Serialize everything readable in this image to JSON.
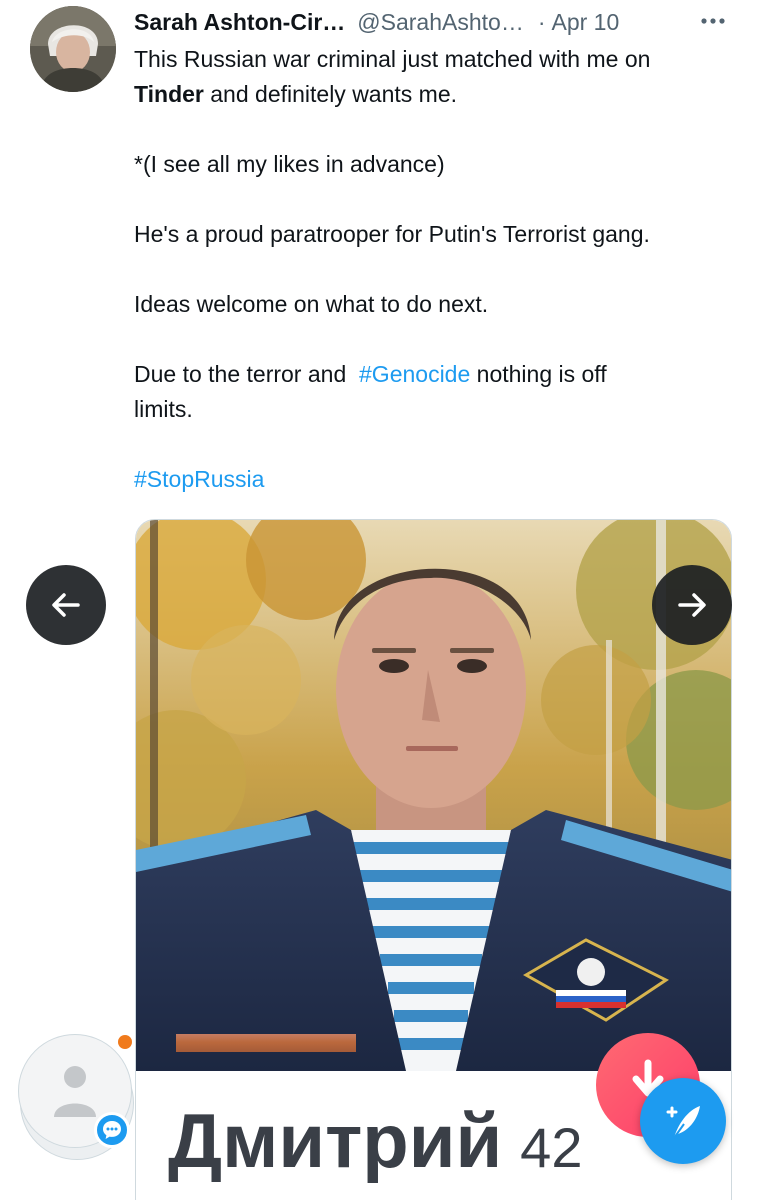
{
  "tweet": {
    "display_name": "Sarah Ashton-Cir…",
    "handle": "@SarahAshto…",
    "separator": "·",
    "date": "Apr 10",
    "more_icon": "more-horizontal-icon",
    "text": {
      "line1": "This Russian war criminal just matched with me on",
      "line2_bold": "Tinder",
      "line2_rest": " and definitely wants me.",
      "line3": "*(I see all my likes in advance)",
      "line4": "He's a proud paratrooper for Putin's Terrorist gang.",
      "line5": "Ideas welcome on what to do next.",
      "line6_start": "Due to the terror and  ",
      "line6_hashtag": "#Genocide",
      "line6_end": " nothing is off",
      "line7": "limits.",
      "hashtag2": "#StopRussia"
    }
  },
  "media": {
    "profile_name": "Дмитрий",
    "profile_age": "42"
  },
  "carousel": {
    "prev_icon": "arrow-left-icon",
    "next_icon": "arrow-right-icon"
  },
  "floating": {
    "tinder_action_icon": "arrow-down-icon",
    "compose_icon": "compose-feather-icon",
    "account_icon": "default-avatar-icon",
    "messages_icon": "messages-icon"
  },
  "colors": {
    "link": "#1d9bf0",
    "text": "#0f1419",
    "muted": "#536471",
    "tinder_red": "#fd3d6a",
    "notification": "#f07a1c"
  }
}
